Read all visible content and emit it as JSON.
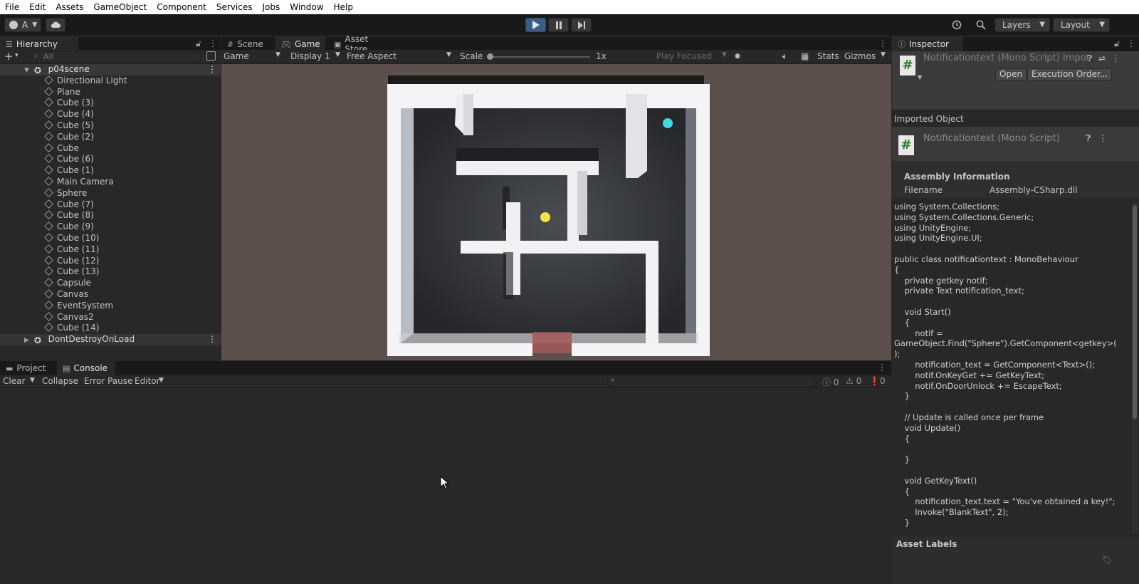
{
  "menubar": [
    "File",
    "Edit",
    "Assets",
    "GameObject",
    "Component",
    "Services",
    "Jobs",
    "Window",
    "Help"
  ],
  "toolbar": {
    "account_label": "A",
    "layers_label": "Layers",
    "layout_label": "Layout"
  },
  "hierarchy": {
    "tab_label": "Hierarchy",
    "search_placeholder": "All",
    "scene_name": "p04scene",
    "items": [
      "Directional Light",
      "Plane",
      "Cube (3)",
      "Cube (4)",
      "Cube (5)",
      "Cube (2)",
      "Cube",
      "Cube (6)",
      "Cube (1)",
      "Main Camera",
      "Sphere",
      "Cube (7)",
      "Cube (8)",
      "Cube (9)",
      "Cube (10)",
      "Cube (11)",
      "Cube (12)",
      "Cube (13)",
      "Capsule",
      "Canvas",
      "EventSystem",
      "Canvas2",
      "Cube (14)"
    ],
    "ddol_name": "DontDestroyOnLoad"
  },
  "game_tabs": [
    "Scene",
    "Game",
    "Asset Store"
  ],
  "game_toolbar": {
    "view_mode": "Game",
    "display": "Display 1",
    "aspect": "Free Aspect",
    "scale_label": "Scale",
    "scale_value": "1x",
    "play_focused": "Play Focused",
    "stats": "Stats",
    "gizmos": "Gizmos"
  },
  "bottom_tabs": [
    "Project",
    "Console"
  ],
  "console_toolbar": {
    "clear": "Clear",
    "collapse": "Collapse",
    "error_pause": "Error Pause",
    "editor": "Editor",
    "log_count": "0",
    "warn_count": "0",
    "error_count": "0"
  },
  "inspector": {
    "tab_label": "Inspector",
    "header_title": "Notificationtext (Mono Script) Impor",
    "open_btn": "Open",
    "exec_order_btn": "Execution Order...",
    "imported_object_label": "Imported Object",
    "object_title": "Notificationtext (Mono Script)",
    "assembly_info_label": "Assembly Information",
    "filename_label": "Filename",
    "filename_value": "Assembly-CSharp.dll",
    "code": "using System.Collections;\nusing System.Collections.Generic;\nusing UnityEngine;\nusing UnityEngine.UI;\n\npublic class notificationtext : MonoBehaviour\n{\n    private getkey notif;\n    private Text notification_text;\n\n    void Start()\n    {\n        notif =\nGameObject.Find(\"Sphere\").GetComponent<getkey>(\n);\n        notification_text = GetComponent<Text>();\n        notif.OnKeyGet += GetKeyText;\n        notif.OnDoorUnlock += EscapeText;\n    }\n\n    // Update is called once per frame\n    void Update()\n    {\n\n    }\n\n    void GetKeyText()\n    {\n        notification_text.text = \"You've obtained a key!\";\n        Invoke(\"BlankText\", 2);\n    }",
    "asset_labels_label": "Asset Labels"
  },
  "colors": {
    "play_active": "#3a5d88",
    "sphere_cyan": "#3fd8e8",
    "key_yellow": "#f5e642",
    "door_red": "#a3585a"
  }
}
